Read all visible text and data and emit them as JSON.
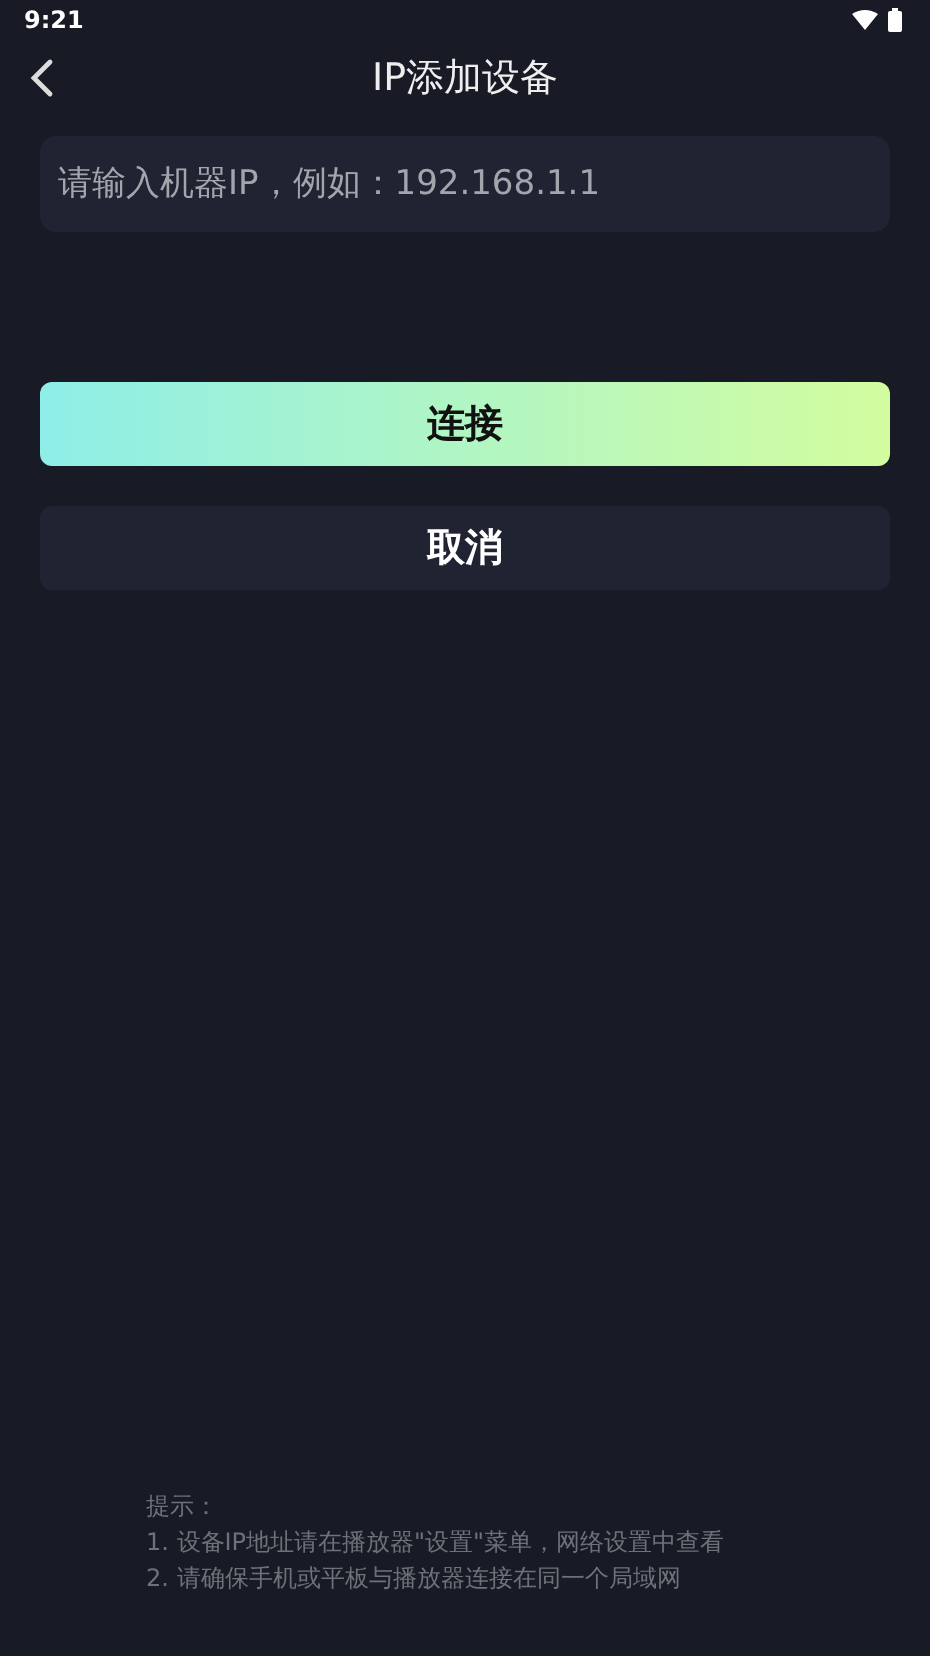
{
  "status_bar": {
    "time": "9:21"
  },
  "header": {
    "title": "IP添加设备"
  },
  "ip_field": {
    "placeholder": "请输入机器IP，例如：192.168.1.1"
  },
  "buttons": [
    {
      "label": "连接",
      "kind": "primary"
    },
    {
      "label": "取消",
      "kind": "secondary"
    }
  ],
  "tips": {
    "heading": "提示：",
    "lines": [
      "1. 设备IP地址请在播放器\"设置\"菜单，网络设置中查看",
      "2. 请确保手机或平板与播放器连接在同一个局域网"
    ]
  }
}
